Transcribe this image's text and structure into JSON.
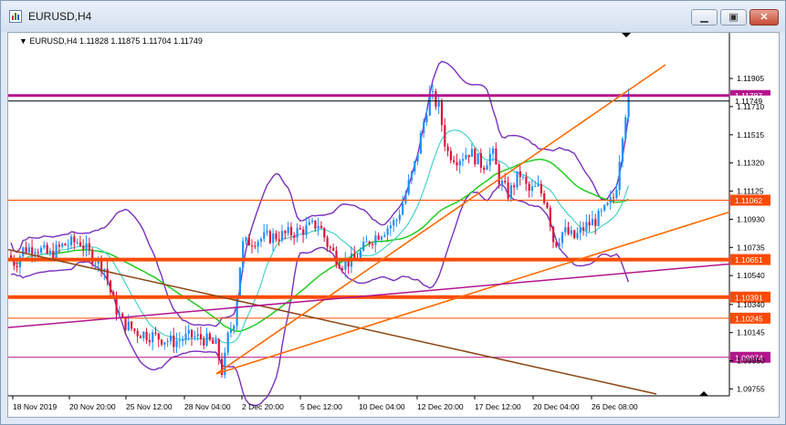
{
  "window": {
    "title": "EURUSD,H4",
    "icon": "chart-window-icon",
    "controls": [
      {
        "name": "minimize",
        "glyph": "▁"
      },
      {
        "name": "restore",
        "glyph": "▣"
      },
      {
        "name": "close",
        "glyph": "✕"
      }
    ]
  },
  "chart": {
    "legend_symbol": "EURUSD,H4",
    "legend_values": "1.11828 1.11875 1.11704 1.11749",
    "price_ticks": [
      "1.11905",
      "1.11710",
      "1.11515",
      "1.11320",
      "1.11125",
      "1.10930",
      "1.10735",
      "1.10540",
      "1.10340",
      "1.10145",
      "1.09950",
      "1.09755"
    ],
    "time_ticks": [
      "18 Nov 2019",
      "20 Nov 20:00",
      "25 Nov 12:00",
      "28 Nov 04:00",
      "2 Dec 20:00",
      "5 Dec 12:00",
      "10 Dec 04:00",
      "12 Dec 20:00",
      "17 Dec 12:00",
      "20 Dec 04:00",
      "26 Dec 08:00"
    ],
    "level_labels": [
      {
        "value": "1.11787",
        "color": "#b4148c"
      },
      {
        "value": "1.11749",
        "color": "#000000"
      },
      {
        "value": "1.11062",
        "color": "#ff4a00"
      },
      {
        "value": "1.10651",
        "color": "#ff4a00"
      },
      {
        "value": "1.10391",
        "color": "#ff4a00"
      },
      {
        "value": "1.10245",
        "color": "#ff4a00"
      },
      {
        "value": "1.09974",
        "color": "#b4148c"
      }
    ],
    "colors": {
      "bull": "#1e90ff",
      "bear": "#dc143c",
      "bands": "#7b2fbe",
      "ma_slow": "#22cc22",
      "ma_fast": "#48d1cc",
      "trend_orange": "#ff6a00",
      "trend_brown": "#8b4513",
      "trend_magenta": "#b4148c"
    }
  }
}
